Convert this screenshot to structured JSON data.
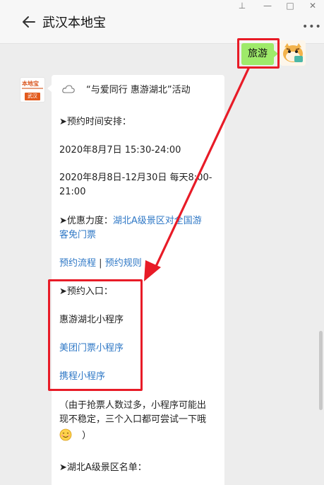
{
  "window": {
    "pin_icon": "pin-icon",
    "min_icon": "minimize-icon",
    "max_icon": "maximize-icon",
    "close_icon": "close-icon"
  },
  "header": {
    "title": "武汉本地宝",
    "back_icon": "back-arrow-icon",
    "more_icon": "more-icon"
  },
  "outgoing": {
    "text": "旅游"
  },
  "bot": {
    "avatar_top": "本地宝",
    "avatar_tag": "武汉"
  },
  "message": {
    "title": "“与爱同行 惠游湖北”活动",
    "schedule_heading": "➤预约时间安排：",
    "date1": "2020年8月7日  15:30-24:00",
    "date2_line1": "2020年8月8日-12月30日  每天8:00-",
    "date2_line2": "21:00",
    "discount_label": "➤优惠力度：",
    "discount_link_1": "湖北A级景区对全国游",
    "discount_link_2": "客免门票",
    "link_process": "预约流程",
    "link_sep": "|",
    "link_rules": "预约规则",
    "entry_heading": "➤预约入口：",
    "entry_1": "惠游湖北小程序",
    "entry_2": "美团门票小程序",
    "entry_3": "携程小程序",
    "note_line1": "（由于抢票人数过多，小程序可能出",
    "note_line2": "现不稳定，三个入口都可尝试一下哦",
    "note_line3": "）",
    "list_heading": "➤湖北A级景区名单："
  },
  "colors": {
    "background": "#ededed",
    "bubble_green": "#9eea6a",
    "highlight_red": "#e81b27",
    "link_blue": "#2f78c6"
  }
}
